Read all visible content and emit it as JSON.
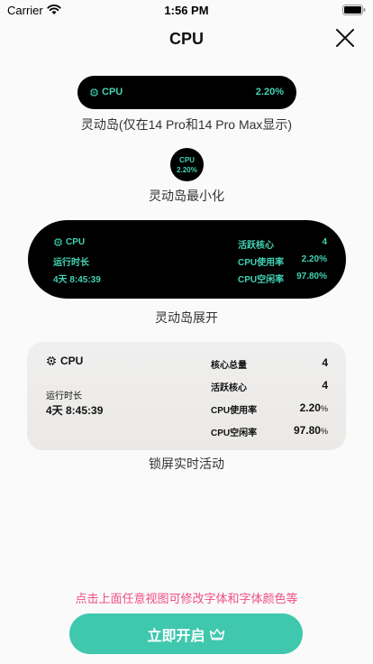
{
  "status_bar": {
    "carrier": "Carrier",
    "time": "1:56 PM"
  },
  "nav": {
    "title": "CPU"
  },
  "pill": {
    "label": "CPU",
    "value": "2.20%",
    "caption": "灵动岛(仅在14 Pro和14 Pro Max显示)"
  },
  "minimal": {
    "label": "CPU",
    "value": "2.20%",
    "caption": "灵动岛最小化"
  },
  "expanded": {
    "label": "CPU",
    "uptime_label": "运行时长",
    "uptime_value": "4天 8:45:39",
    "active_cores_label": "活跃核心",
    "active_cores_value": "4",
    "usage_label": "CPU使用率",
    "usage_value": "2.20%",
    "idle_label": "CPU空闲率",
    "idle_value": "97.80%",
    "caption": "灵动岛展开"
  },
  "lockscreen": {
    "label": "CPU",
    "uptime_label": "运行时长",
    "uptime_value": "4天 8:45:39",
    "total_cores_label": "核心总量",
    "total_cores_value": "4",
    "active_cores_label": "活跃核心",
    "active_cores_value": "4",
    "usage_label": "CPU使用率",
    "usage_value": "2.20",
    "usage_unit": "%",
    "idle_label": "CPU空闲率",
    "idle_value": "97.80",
    "idle_unit": "%",
    "caption": "锁屏实时活动"
  },
  "hint": "点击上面任意视图可修改字体和字体颜色等",
  "cta": {
    "label": "立即开启"
  },
  "colors": {
    "accent": "#42d3b4",
    "button": "#3fc8ad",
    "hint": "#f04d86"
  }
}
